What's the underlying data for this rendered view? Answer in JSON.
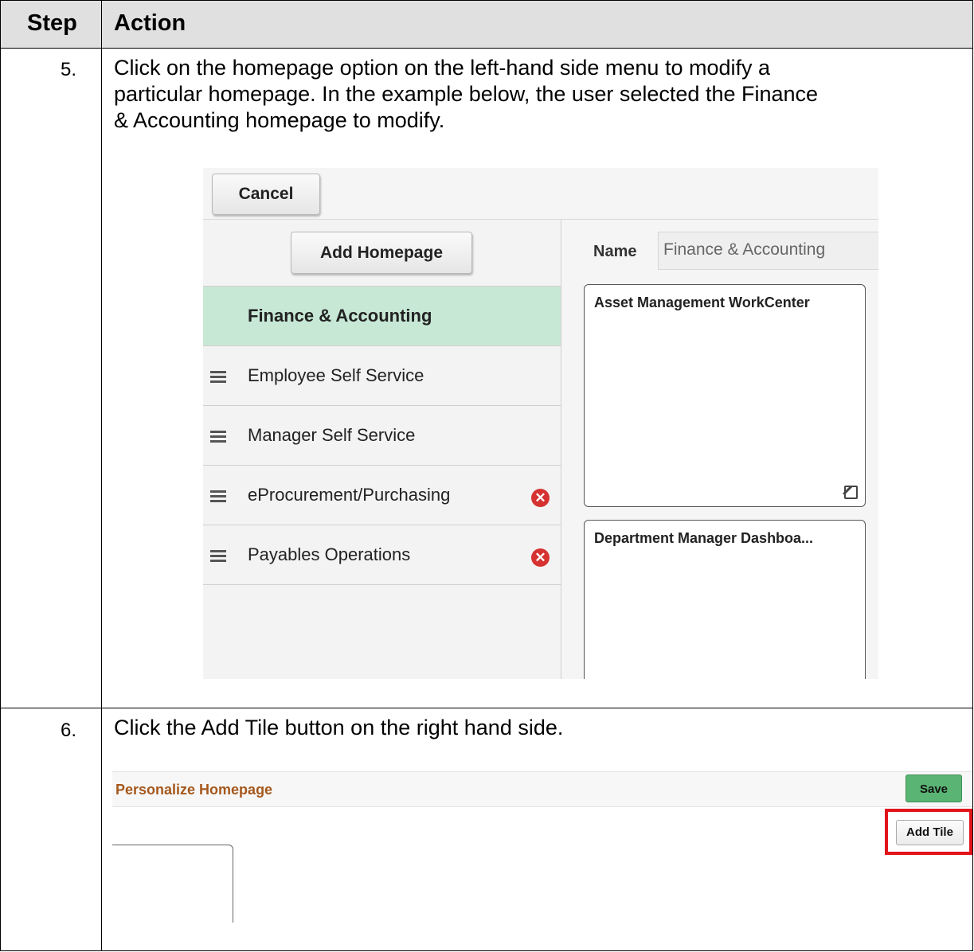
{
  "table": {
    "header": {
      "step": "Step",
      "action": "Action"
    },
    "rows": [
      {
        "step": "5.",
        "action_lines": [
          "Click on the homepage option on the left-hand side menu to modify a",
          "particular homepage. In the example below, the user selected the Finance",
          "& Accounting homepage to modify."
        ]
      },
      {
        "step": "6.",
        "action_lines": [
          "Click the Add Tile button on the right hand side."
        ]
      }
    ]
  },
  "shot1": {
    "cancel_label": "Cancel",
    "add_homepage_label": "Add Homepage",
    "name_label": "Name",
    "name_value": "Finance & Accounting",
    "menu": [
      {
        "label": "Finance & Accounting",
        "selected": true,
        "grip": false,
        "delete": false
      },
      {
        "label": "Employee Self Service",
        "selected": false,
        "grip": true,
        "delete": false
      },
      {
        "label": "Manager Self Service",
        "selected": false,
        "grip": true,
        "delete": false
      },
      {
        "label": "eProcurement/Purchasing",
        "selected": false,
        "grip": true,
        "delete": true
      },
      {
        "label": "Payables Operations",
        "selected": false,
        "grip": true,
        "delete": true
      }
    ],
    "tiles": [
      "Asset Management WorkCenter",
      "Department Manager Dashboa..."
    ]
  },
  "shot2": {
    "title": "Personalize Homepage",
    "save_label": "Save",
    "add_tile_label": "Add Tile",
    "highlight_color": "#e2141b"
  },
  "icons": {
    "delete": "x-circle-icon",
    "grip": "drag-handle-icon",
    "edit": "edit-icon"
  }
}
